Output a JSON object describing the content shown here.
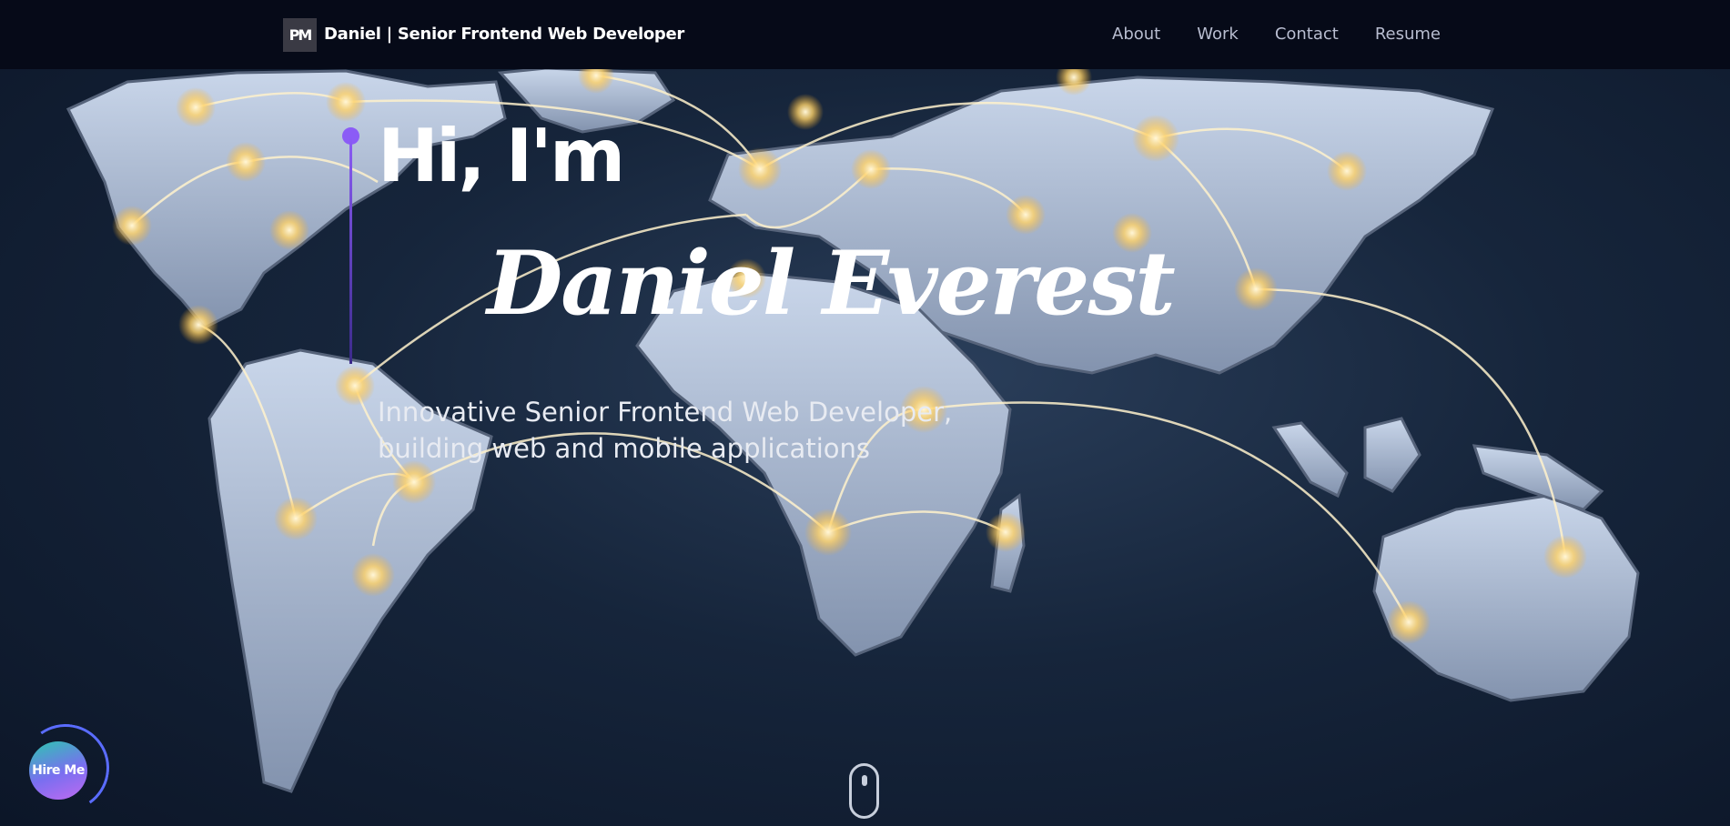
{
  "header": {
    "logo_text": "PM",
    "brand": "Daniel  | Senior Frontend Web Developer",
    "nav": [
      {
        "label": "About"
      },
      {
        "label": "Work"
      },
      {
        "label": "Contact"
      },
      {
        "label": "Resume"
      }
    ]
  },
  "hero": {
    "greeting": "Hi, I'm",
    "name": "Daniel Everest",
    "tagline": "Innovative Senior Frontend Web Developer, building web and mobile applications",
    "background_image": "world-map-network-icon"
  },
  "hire_button": {
    "label": "Hire Me"
  },
  "scroll_indicator": {
    "icon": "mouse-scroll-icon"
  },
  "colors": {
    "nav_bg": "#060a18",
    "accent": "#8b5cf6",
    "hire_gradient_start": "#2cc7b0",
    "hire_gradient_end": "#c06bf0"
  }
}
